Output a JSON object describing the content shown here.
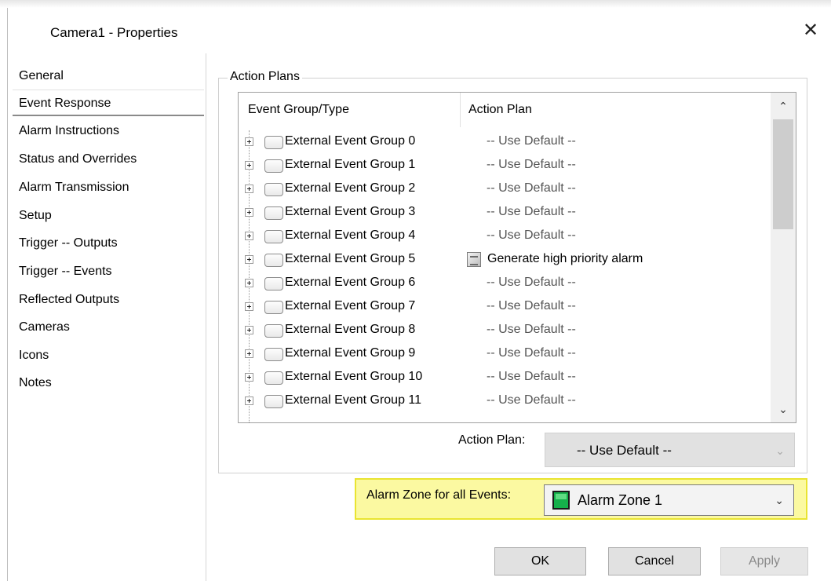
{
  "window": {
    "title": "Camera1 - Properties",
    "close_glyph": "✕"
  },
  "nav": {
    "selected": "Event Response",
    "items": [
      "General",
      "Event Response",
      "Alarm Instructions",
      "Status and Overrides",
      "Alarm Transmission",
      "Setup",
      "Trigger -- Outputs",
      "Trigger -- Events",
      "Reflected Outputs",
      "Cameras",
      "Icons",
      "Notes"
    ]
  },
  "action_plans": {
    "group_label": "Action Plans",
    "columns": [
      "Event Group/Type",
      "Action Plan"
    ],
    "rows": [
      {
        "label": "External Event Group 0",
        "plan": "-- Use Default --"
      },
      {
        "label": "External Event Group 1",
        "plan": "-- Use Default --"
      },
      {
        "label": "External Event Group 2",
        "plan": "-- Use Default --"
      },
      {
        "label": "External Event Group 3",
        "plan": "-- Use Default --"
      },
      {
        "label": "External Event Group 4",
        "plan": "-- Use Default --"
      },
      {
        "label": "External Event Group 5",
        "plan": "Generate high priority alarm",
        "plan_icon": "action-plan-icon"
      },
      {
        "label": "External Event Group 6",
        "plan": "-- Use Default --"
      },
      {
        "label": "External Event Group 7",
        "plan": "-- Use Default --"
      },
      {
        "label": "External Event Group 8",
        "plan": "-- Use Default --"
      },
      {
        "label": "External Event Group 9",
        "plan": "-- Use Default --"
      },
      {
        "label": "External Event Group 10",
        "plan": "-- Use Default --"
      },
      {
        "label": "External Event Group 11",
        "plan": "-- Use Default --"
      }
    ],
    "scroll_up_glyph": "⌃",
    "scroll_down_glyph": "⌄",
    "action_plan_label": "Action Plan:",
    "action_plan_value": "-- Use Default --"
  },
  "alarm_zone": {
    "label": "Alarm Zone for all Events:",
    "value": "Alarm Zone 1",
    "swatch_color": "#15b04b",
    "highlight_color": "#fbf9a1"
  },
  "buttons": {
    "ok": "OK",
    "cancel": "Cancel",
    "apply": "Apply"
  },
  "icons": [
    "close-icon",
    "expander-plus-icon",
    "folder-icon",
    "action-plan-icon",
    "chevron-down-icon",
    "chevron-up-icon",
    "zone-color-icon"
  ]
}
